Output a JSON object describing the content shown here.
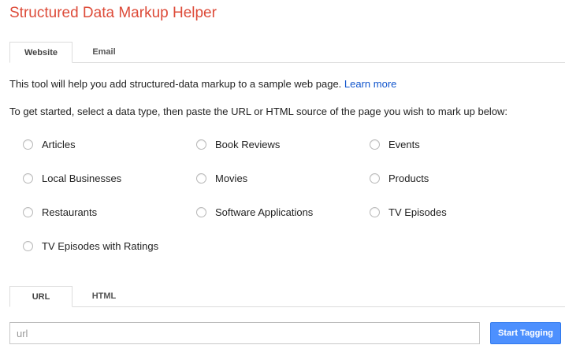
{
  "title": "Structured Data Markup Helper",
  "top_tabs": [
    {
      "label": "Website",
      "active": true
    },
    {
      "label": "Email",
      "active": false
    }
  ],
  "intro": {
    "text": "This tool will help you add structured-data markup to a sample web page.",
    "link": "Learn more"
  },
  "instruction": "To get started, select a data type, then paste the URL or HTML source of the page you wish to mark up below:",
  "data_types": [
    "Articles",
    "Book Reviews",
    "Events",
    "Local Businesses",
    "Movies",
    "Products",
    "Restaurants",
    "Software Applications",
    "TV Episodes",
    "TV Episodes with Ratings"
  ],
  "source_tabs": [
    {
      "label": "URL",
      "active": true
    },
    {
      "label": "HTML",
      "active": false
    }
  ],
  "url_input": {
    "placeholder": "url",
    "value": ""
  },
  "start_button": "Start Tagging",
  "colors": {
    "title": "#dd4b39",
    "link": "#1155cc",
    "button": "#4d90fe"
  }
}
